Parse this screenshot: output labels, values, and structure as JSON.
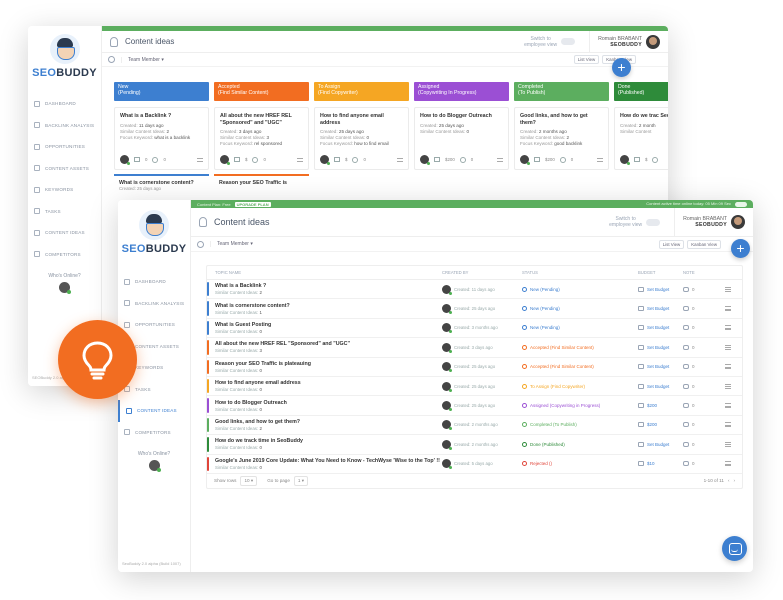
{
  "app": {
    "name_left": "SEO",
    "name_right": "BUDDY"
  },
  "back": {
    "nav": [
      "DASHBOARD",
      "BACKLINK ANALYSIS",
      "OPPORTUNITIES",
      "CONTENT ASSETS",
      "KEYWORDS",
      "TASKS",
      "CONTENT IDEAS",
      "COMPETITORS"
    ],
    "whos_online": "Who's Online?",
    "footer": "SEOBuddy 2.0 alpha",
    "title": "Content ideas",
    "switch_label_1": "Switch to",
    "switch_label_2": "employee view",
    "user_name": "Romain BRABANT",
    "user_org": "SEOBUDDY",
    "team_member": "Team Member",
    "list_view": "List View",
    "kanban_view": "Kanban View",
    "columns": [
      {
        "head1": "New",
        "head2": "(Pending)",
        "color": "#3d7fd0",
        "card": {
          "title": "What is a Backlink ?",
          "l1k": "Created:",
          "l1v": "11 days ago",
          "l2k": "Similar Content Ideas:",
          "l2v": "2",
          "l3k": "Focus Keyword:",
          "l3v": "what is a backlink",
          "folder": "0",
          "comments": "0"
        },
        "card2": {
          "title": "What is cornerstone content?",
          "sub": "Created: 25 days ago"
        }
      },
      {
        "head1": "Accepted",
        "head2": "(Find Similar Content)",
        "color": "#f26d21",
        "card": {
          "title": "All about the new HREF REL \"Sponsored\" and \"UGC\"",
          "l1k": "Created:",
          "l1v": "3 days ago",
          "l2k": "Similar Content Ideas:",
          "l2v": "3",
          "l3k": "Focus Keyword:",
          "l3v": "rel sponsored",
          "folder": "$",
          "comments": "0"
        },
        "card2": {
          "title": "Reason your SEO Traffic is",
          "sub": ""
        }
      },
      {
        "head1": "To Assign",
        "head2": "(Find Copywriter)",
        "color": "#f5a623",
        "card": {
          "title": "How to find anyone email address",
          "l1k": "Created:",
          "l1v": "25 days ago",
          "l2k": "Similar Content Ideas:",
          "l2v": "0",
          "l3k": "Focus Keyword:",
          "l3v": "how to find email",
          "folder": "$",
          "comments": "0"
        },
        "card2": null
      },
      {
        "head1": "Assigned",
        "head2": "(Copywriting In Progress)",
        "color": "#9b4fd4",
        "card": {
          "title": "How to do Blogger Outreach",
          "l1k": "Created:",
          "l1v": "25 days ago",
          "l2k": "Similar Content Ideas:",
          "l2v": "0",
          "l3k": "",
          "l3v": "",
          "folder": "$200",
          "comments": "0"
        },
        "card2": null
      },
      {
        "head1": "Completed",
        "head2": "(To Publish)",
        "color": "#5cae5f",
        "card": {
          "title": "Good links, and how to get them?",
          "l1k": "Created:",
          "l1v": "2 months ago",
          "l2k": "Similar Content Ideas:",
          "l2v": "2",
          "l3k": "Focus Keyword:",
          "l3v": "good backlink",
          "folder": "$200",
          "comments": "0"
        },
        "card2": null
      },
      {
        "head1": "Done",
        "head2": "(Published)",
        "color": "#2e8b3a",
        "card": {
          "title": "How do we trac SeoBuddy",
          "l1k": "Created:",
          "l1v": "2 month",
          "l2k": "Similar Content",
          "l2v": "",
          "l3k": "",
          "l3v": "",
          "folder": "$",
          "comments": ""
        },
        "card2": null
      }
    ]
  },
  "front": {
    "topstrip_left": "Content Plan: Free",
    "upgrade": "UPGRADE PLAN",
    "topstrip_right": "Content active time online today: 05 Min 09 Sec",
    "nav": [
      "DASHBOARD",
      "BACKLINK ANALYSIS",
      "OPPORTUNITIES",
      "CONTENT ASSETS",
      "KEYWORDS",
      "TASKS",
      "CONTENT IDEAS",
      "COMPETITORS"
    ],
    "whos_online": "Who's Online?",
    "footer": "SeoBuddy 2.0 alpha (Build 1007)",
    "title": "Content ideas",
    "switch_label_1": "Switch to",
    "switch_label_2": "employee view",
    "user_name": "Romain BRABANT",
    "user_org": "SEOBUDDY",
    "team_member": "Team Member",
    "list_view": "List View",
    "kanban_view": "Kanban View",
    "table": {
      "headers": [
        "TOPIC NAME",
        "CREATED BY",
        "STATUS",
        "BUDGET",
        "NOTE"
      ],
      "rows": [
        {
          "title": "What is a Backlink ?",
          "similar": "2",
          "created": "Created: 11 days ago",
          "status": "New (Pending)",
          "status_color": "#3d7fd0",
          "budget": "Set Budget",
          "comments": "0"
        },
        {
          "title": "What is cornerstone content?",
          "similar": "1",
          "created": "Created: 25 days ago",
          "status": "New (Pending)",
          "status_color": "#3d7fd0",
          "budget": "Set Budget",
          "comments": "0"
        },
        {
          "title": "What is Guest Posting",
          "similar": "0",
          "created": "Created: 3 months ago",
          "status": "New (Pending)",
          "status_color": "#3d7fd0",
          "budget": "Set Budget",
          "comments": "0"
        },
        {
          "title": "All about the new HREF REL \"Sponsored\" and \"UGC\"",
          "similar": "3",
          "created": "Created: 3 days ago",
          "status": "Accepted (Find Similar Content)",
          "status_color": "#f26d21",
          "budget": "Set Budget",
          "comments": "0"
        },
        {
          "title": "Reason your SEO Traffic is plateauing",
          "similar": "0",
          "created": "Created: 25 days ago",
          "status": "Accepted (Find Similar Content)",
          "status_color": "#f26d21",
          "budget": "Set Budget",
          "comments": "0"
        },
        {
          "title": "How to find anyone email address",
          "similar": "0",
          "created": "Created: 25 days ago",
          "status": "To Assign (Find Copywriter)",
          "status_color": "#f5a623",
          "budget": "Set Budget",
          "comments": "0"
        },
        {
          "title": "How to do Blogger Outreach",
          "similar": "0",
          "created": "Created: 25 days ago",
          "status": "Assigned (Copywriting in Progress)",
          "status_color": "#9b4fd4",
          "budget": "$200",
          "comments": "0"
        },
        {
          "title": "Good links, and how to get them?",
          "similar": "2",
          "created": "Created: 2 months ago",
          "status": "Completed (To Publish)",
          "status_color": "#5cae5f",
          "budget": "$200",
          "comments": "0"
        },
        {
          "title": "How do we track time in SeoBuddy",
          "similar": "0",
          "created": "Created: 2 months ago",
          "status": "Done (Published)",
          "status_color": "#2e8b3a",
          "budget": "Set Budget",
          "comments": "0"
        },
        {
          "title": "Google's June 2019 Core Update: What You Need to Know - TechWyse 'Wise to the Top' !!",
          "similar": "0",
          "created": "Created: 5 days ago",
          "status": "Rejected ()",
          "status_color": "#e0453a",
          "budget": "$10",
          "comments": "0"
        }
      ],
      "similar_label": "Similar Content Ideas:",
      "show_rows_label": "Show rows",
      "show_rows_value": "10",
      "go_to_page_label": "Go to page",
      "go_to_page_value": "1",
      "pagination": "1-10 of 11"
    }
  }
}
